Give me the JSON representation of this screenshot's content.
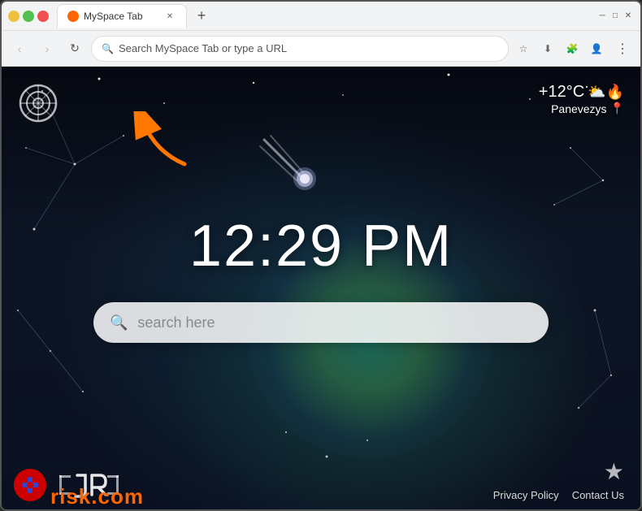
{
  "browser": {
    "tab_title": "MySpace Tab",
    "tab_favicon": "🟠",
    "new_tab_icon": "+",
    "back_icon": "←",
    "forward_icon": "→",
    "refresh_icon": "↻",
    "address_placeholder": "Search MySpace Tab or type a URL",
    "bookmark_icon": "☆",
    "extensions_icon": "🧩",
    "profile_icon": "👤",
    "menu_icon": "⋮",
    "minimize_icon": "_",
    "maximize_icon": "□",
    "close_icon": "✕",
    "download_icon": "⬇"
  },
  "page": {
    "time": "12:29 PM",
    "weather_temp": "+12°C",
    "weather_city": "Panevezys",
    "weather_cloud": "⛅",
    "weather_hot": "🔥",
    "location_pin": "📍",
    "search_placeholder": "search here",
    "comet_icon": "☄",
    "star_icon": "★",
    "privacy_policy": "Privacy Policy",
    "contact_us": "Contact Us",
    "risk_watermark": "risk.com",
    "arrow_label": "orange arrow pointing up-left"
  }
}
